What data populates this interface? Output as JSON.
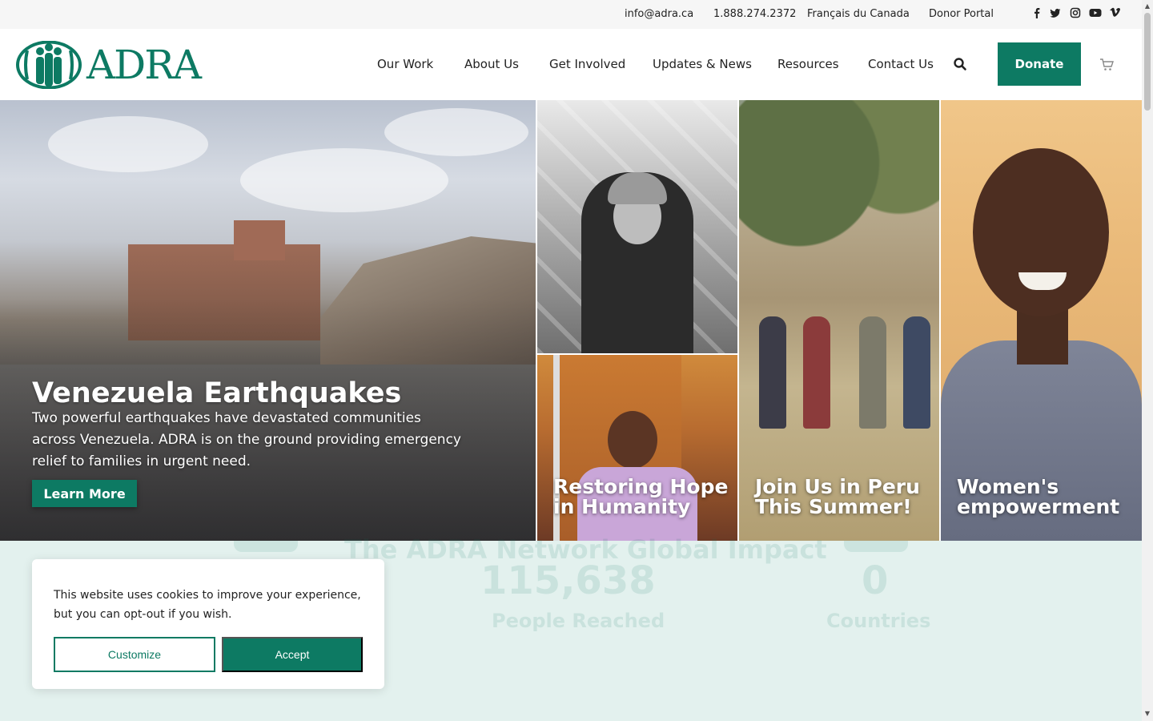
{
  "topbar": {
    "email": "info@adra.ca",
    "phone": "1.888.274.2372",
    "language": "Français du Canada",
    "donor_portal": "Donor Portal",
    "social": [
      "facebook-icon",
      "twitter-icon",
      "instagram-icon",
      "youtube-icon",
      "vimeo-icon"
    ]
  },
  "header": {
    "logo_text": "ADRA",
    "nav": [
      "Our Work",
      "About Us",
      "Get Involved",
      "Updates & News",
      "Resources",
      "Contact Us"
    ],
    "donate_label": "Donate"
  },
  "hero": {
    "title": "Venezuela Earthquakes",
    "description": "Two powerful earthquakes have devastated communities across Venezuela. ADRA is on the ground providing emergency relief to families in urgent need.",
    "cta": "Learn More",
    "tiles": [
      "Restoring Hope in Humanity",
      "Join Us in Peru This Summer!",
      "Women's empowerment"
    ]
  },
  "impact": {
    "title": "The ADRA Network Global Impact",
    "stats": [
      {
        "value": "115,638",
        "label": "People Reached"
      },
      {
        "value": "0",
        "label": "Countries"
      }
    ]
  },
  "cookie": {
    "text": "This website uses cookies to improve your experience, but you can opt-out if you wish.",
    "customize": "Customize",
    "accept": "Accept"
  },
  "colors": {
    "brand_green": "#0d7a63",
    "impact_bg": "#e3f1ee",
    "topbar_bg": "#f6f6f6"
  }
}
